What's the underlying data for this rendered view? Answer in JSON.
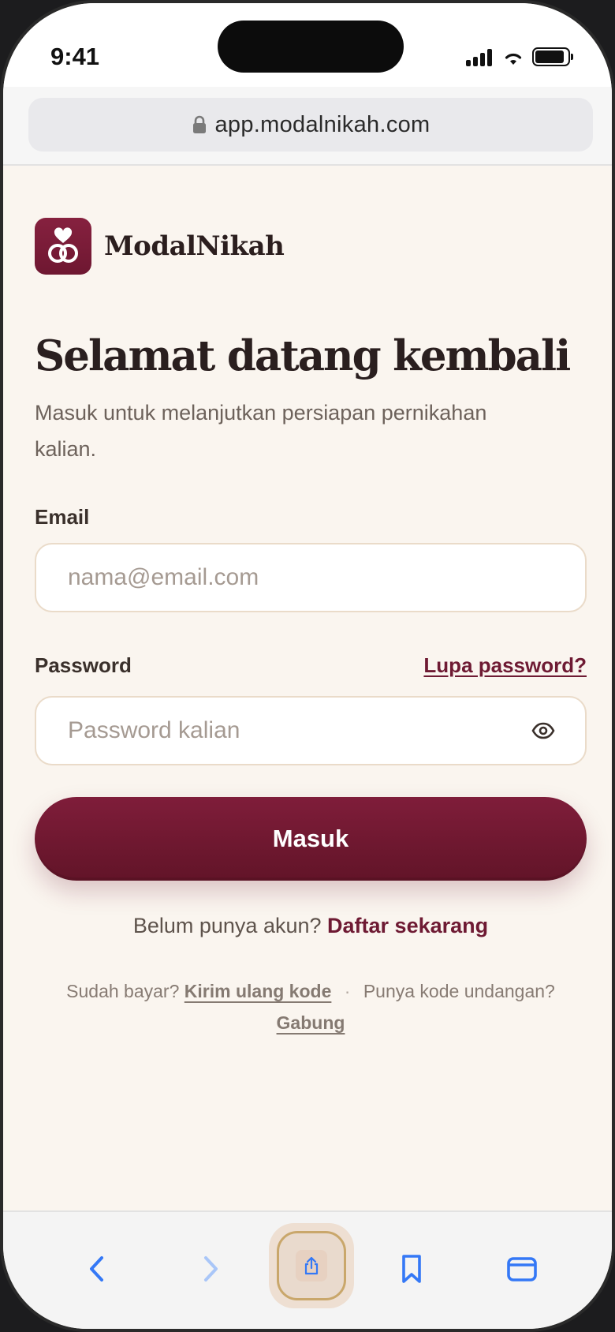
{
  "status": {
    "time": "9:41"
  },
  "browser": {
    "url": "app.modalnikah.com"
  },
  "brand": {
    "name": "ModalNikah"
  },
  "login": {
    "title": "Selamat datang kembali",
    "subtitle": "Masuk untuk melanjutkan persiapan pernikahan kalian.",
    "email_label": "Email",
    "email_placeholder": "nama@email.com",
    "password_label": "Password",
    "forgot_link": "Lupa password?",
    "password_placeholder": "Password kalian",
    "submit_label": "Masuk",
    "register_prompt": "Belum punya akun?",
    "register_link": "Daftar sekarang",
    "paid_prompt": "Sudah bayar?",
    "resend_link": "Kirim ulang kode",
    "invite_prompt": "Punya kode undangan?",
    "join_link": "Gabung"
  },
  "colors": {
    "brand": "#7a1c37",
    "background": "#faf5ef",
    "ios_blue": "#3478f6"
  },
  "icons": {
    "logo": "rings-heart-icon",
    "lock": "lock-icon",
    "eye": "eye-icon",
    "back": "chevron-left-icon",
    "forward": "chevron-right-icon",
    "share": "share-icon",
    "bookmarks": "bookmark-icon",
    "tabs": "tabs-icon"
  }
}
